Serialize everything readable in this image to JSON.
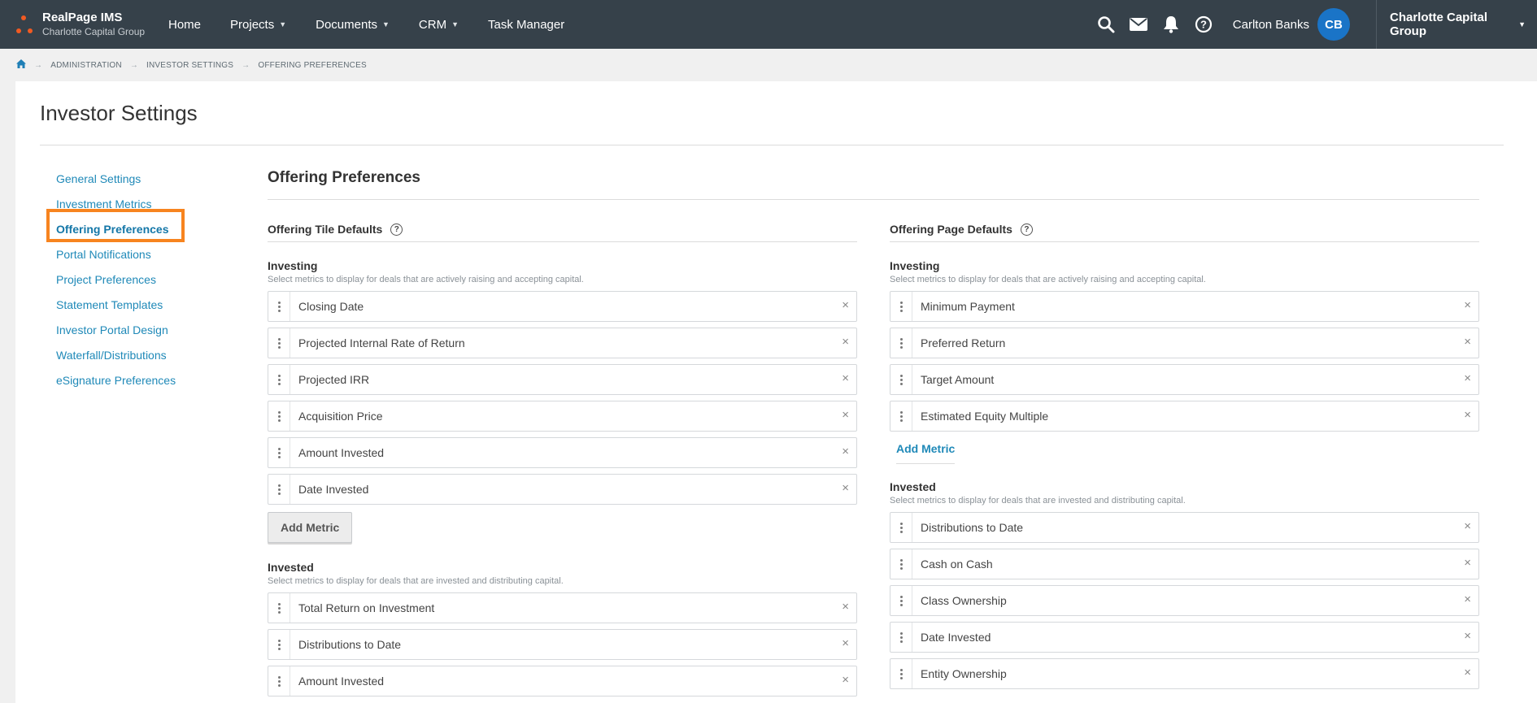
{
  "topbar": {
    "app_name": "RealPage IMS",
    "org_name": "Charlotte Capital Group",
    "nav": [
      {
        "label": "Home",
        "dropdown": false
      },
      {
        "label": "Projects",
        "dropdown": true
      },
      {
        "label": "Documents",
        "dropdown": true
      },
      {
        "label": "CRM",
        "dropdown": true
      },
      {
        "label": "Task Manager",
        "dropdown": false
      }
    ],
    "user_name": "Carlton Banks",
    "user_initials": "CB",
    "org_switcher": "Charlotte Capital Group"
  },
  "breadcrumb": {
    "items": [
      "ADMINISTRATION",
      "INVESTOR SETTINGS",
      "OFFERING PREFERENCES"
    ]
  },
  "page": {
    "title": "Investor Settings"
  },
  "sidebar": {
    "items": [
      {
        "label": "General Settings"
      },
      {
        "label": "Investment Metrics"
      },
      {
        "label": "Offering Preferences"
      },
      {
        "label": "Portal Notifications"
      },
      {
        "label": "Project Preferences"
      },
      {
        "label": "Statement Templates"
      },
      {
        "label": "Investor Portal Design"
      },
      {
        "label": "Waterfall/Distributions"
      },
      {
        "label": "eSignature Preferences"
      }
    ],
    "active_index": 2
  },
  "content": {
    "title": "Offering Preferences",
    "tile_defaults": {
      "heading": "Offering Tile Defaults",
      "investing": {
        "title": "Investing",
        "desc": "Select metrics to display for deals that are actively raising and accepting capital.",
        "metrics": [
          "Closing Date",
          "Projected Internal Rate of Return",
          "Projected IRR",
          "Acquisition Price",
          "Amount Invested",
          "Date Invested"
        ],
        "add_label": "Add Metric"
      },
      "invested": {
        "title": "Invested",
        "desc": "Select metrics to display for deals that are invested and distributing capital.",
        "metrics": [
          "Total Return on Investment",
          "Distributions to Date",
          "Amount Invested"
        ]
      }
    },
    "page_defaults": {
      "heading": "Offering Page Defaults",
      "investing": {
        "title": "Investing",
        "desc": "Select metrics to display for deals that are actively raising and accepting capital.",
        "metrics": [
          "Minimum Payment",
          "Preferred Return",
          "Target Amount",
          "Estimated Equity Multiple"
        ],
        "add_label": "Add Metric"
      },
      "invested": {
        "title": "Invested",
        "desc": "Select metrics to display for deals that are invested and distributing capital.",
        "metrics": [
          "Distributions to Date",
          "Cash on Cash",
          "Class Ownership",
          "Date Invested",
          "Entity Ownership"
        ]
      }
    }
  },
  "icons": {
    "help": "?",
    "remove": "×"
  },
  "colors": {
    "topbar": "#36414a",
    "link": "#1f89b8",
    "highlight": "#f7841f",
    "avatar": "#1a74c7",
    "brand_dot": "#f15a22"
  }
}
